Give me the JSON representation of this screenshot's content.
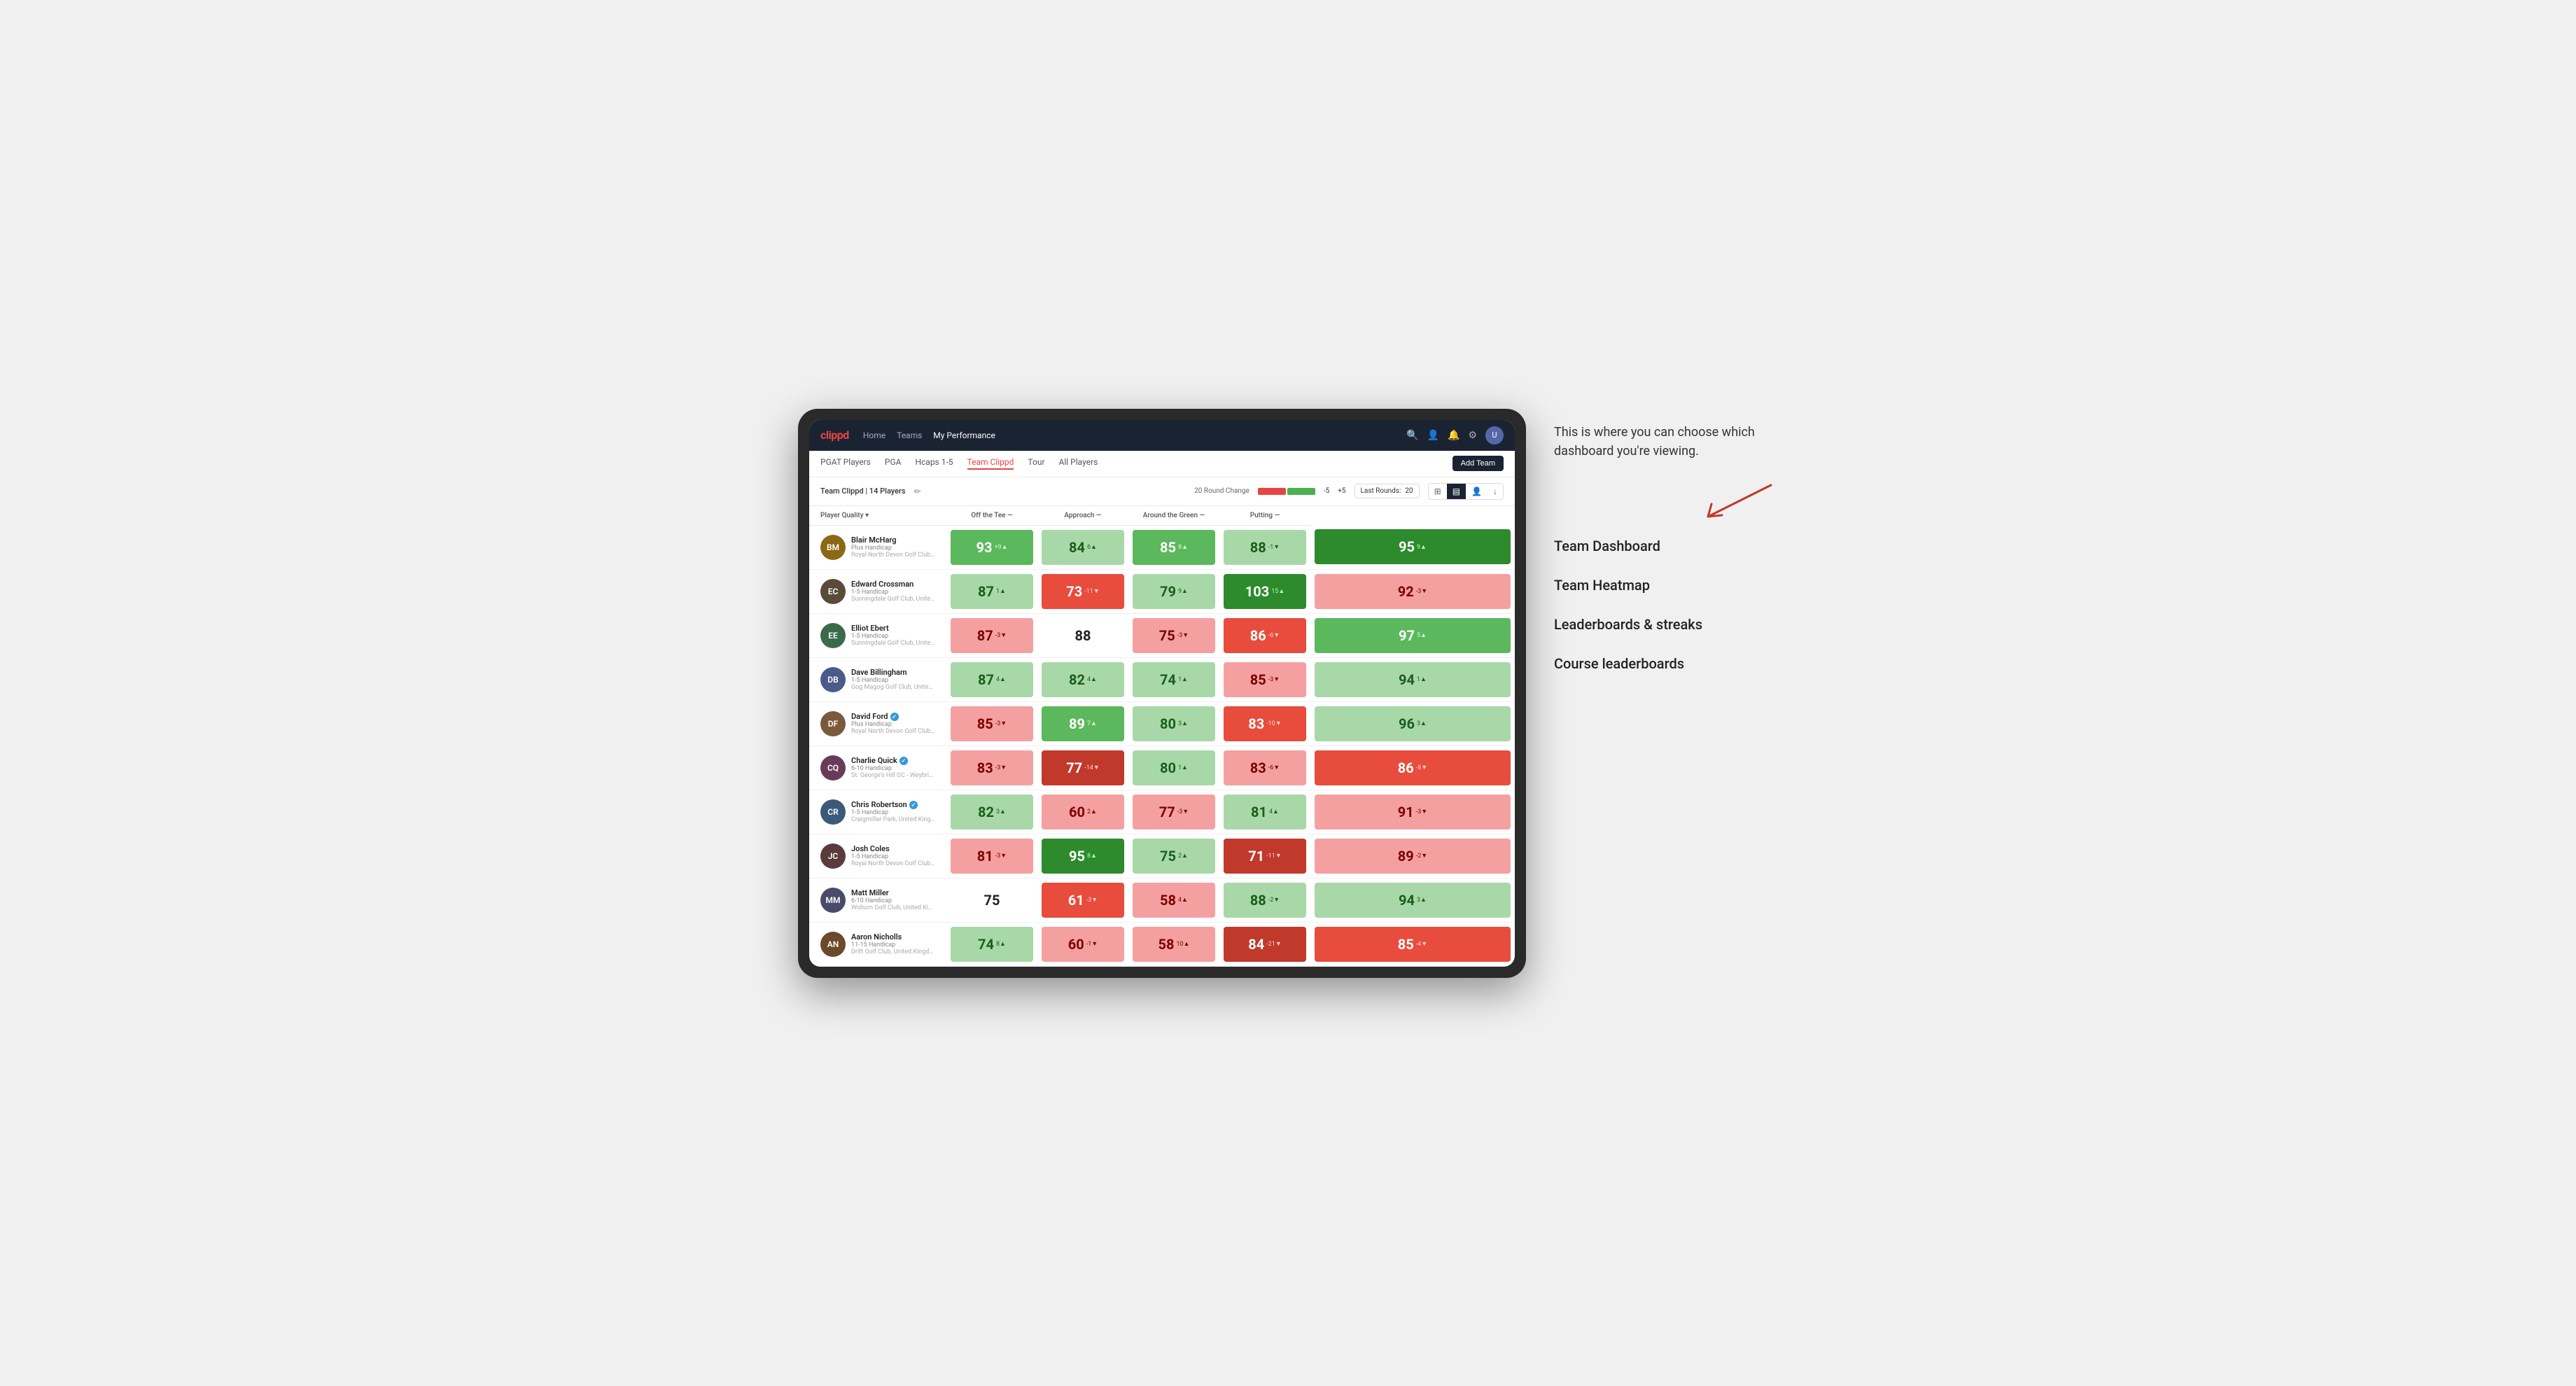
{
  "annotation": {
    "intro_text": "This is where you can choose which dashboard you're viewing.",
    "dashboard_options": [
      "Team Dashboard",
      "Team Heatmap",
      "Leaderboards & streaks",
      "Course leaderboards"
    ]
  },
  "nav": {
    "logo": "clippd",
    "links": [
      "Home",
      "Teams",
      "My Performance"
    ],
    "active_link": "My Performance"
  },
  "sub_nav": {
    "links": [
      "PGAT Players",
      "PGA",
      "Hcaps 1-5",
      "Team Clippd",
      "Tour",
      "All Players"
    ],
    "active_link": "Team Clippd",
    "add_team_label": "Add Team"
  },
  "controls": {
    "team_label": "Team Clippd",
    "player_count": "14 Players",
    "round_change_label": "20 Round Change",
    "change_minus": "-5",
    "change_plus": "+5",
    "last_rounds_label": "Last Rounds:",
    "last_rounds_value": "20"
  },
  "table": {
    "headers": {
      "player": "Player Quality ▾",
      "off_tee": "Off the Tee —",
      "approach": "Approach —",
      "around_green": "Around the Green —",
      "putting": "Putting —"
    },
    "players": [
      {
        "name": "Blair McHarg",
        "handicap": "Plus Handicap",
        "club": "Royal North Devon Golf Club, United Kingdom",
        "avatar_color": "#8B6914",
        "initials": "BM",
        "quality": {
          "value": 93,
          "change": "+9▲",
          "bg": "bg-green-mid"
        },
        "off_tee": {
          "value": 84,
          "change": "6▲",
          "bg": "bg-green-light"
        },
        "approach": {
          "value": 85,
          "change": "8▲",
          "bg": "bg-green-mid"
        },
        "around_green": {
          "value": 88,
          "change": "-1▼",
          "bg": "bg-green-light"
        },
        "putting": {
          "value": 95,
          "change": "9▲",
          "bg": "bg-green-dark"
        }
      },
      {
        "name": "Edward Crossman",
        "handicap": "1-5 Handicap",
        "club": "Sunningdale Golf Club, United Kingdom",
        "avatar_color": "#5a4a3a",
        "initials": "EC",
        "quality": {
          "value": 87,
          "change": "1▲",
          "bg": "bg-green-light"
        },
        "off_tee": {
          "value": 73,
          "change": "-11▼",
          "bg": "bg-red-mid"
        },
        "approach": {
          "value": 79,
          "change": "9▲",
          "bg": "bg-green-light"
        },
        "around_green": {
          "value": 103,
          "change": "15▲",
          "bg": "bg-green-dark"
        },
        "putting": {
          "value": 92,
          "change": "-3▼",
          "bg": "bg-red-light"
        }
      },
      {
        "name": "Elliot Ebert",
        "handicap": "1-5 Handicap",
        "club": "Sunningdale Golf Club, United Kingdom",
        "avatar_color": "#3a6a4a",
        "initials": "EE",
        "quality": {
          "value": 87,
          "change": "-3▼",
          "bg": "bg-red-light"
        },
        "off_tee": {
          "value": 88,
          "change": "",
          "bg": "bg-white"
        },
        "approach": {
          "value": 75,
          "change": "-3▼",
          "bg": "bg-red-light"
        },
        "around_green": {
          "value": 86,
          "change": "-6▼",
          "bg": "bg-red-mid"
        },
        "putting": {
          "value": 97,
          "change": "5▲",
          "bg": "bg-green-mid"
        }
      },
      {
        "name": "Dave Billingham",
        "handicap": "1-5 Handicap",
        "club": "Gog Magog Golf Club, United Kingdom",
        "avatar_color": "#4a5a8a",
        "initials": "DB",
        "quality": {
          "value": 87,
          "change": "4▲",
          "bg": "bg-green-light"
        },
        "off_tee": {
          "value": 82,
          "change": "4▲",
          "bg": "bg-green-light"
        },
        "approach": {
          "value": 74,
          "change": "1▲",
          "bg": "bg-green-light"
        },
        "around_green": {
          "value": 85,
          "change": "-3▼",
          "bg": "bg-red-light"
        },
        "putting": {
          "value": 94,
          "change": "1▲",
          "bg": "bg-green-light"
        }
      },
      {
        "name": "David Ford",
        "handicap": "Plus Handicap",
        "club": "Royal North Devon Golf Club, United Kingdom",
        "avatar_color": "#7a5a3a",
        "initials": "DF",
        "verified": true,
        "quality": {
          "value": 85,
          "change": "-3▼",
          "bg": "bg-red-light"
        },
        "off_tee": {
          "value": 89,
          "change": "7▲",
          "bg": "bg-green-mid"
        },
        "approach": {
          "value": 80,
          "change": "3▲",
          "bg": "bg-green-light"
        },
        "around_green": {
          "value": 83,
          "change": "-10▼",
          "bg": "bg-red-mid"
        },
        "putting": {
          "value": 96,
          "change": "3▲",
          "bg": "bg-green-light"
        }
      },
      {
        "name": "Charlie Quick",
        "handicap": "6-10 Handicap",
        "club": "St. George's Hill GC - Weybridge - Surrey, Uni...",
        "avatar_color": "#6a3a5a",
        "initials": "CQ",
        "verified": true,
        "quality": {
          "value": 83,
          "change": "-3▼",
          "bg": "bg-red-light"
        },
        "off_tee": {
          "value": 77,
          "change": "-14▼",
          "bg": "bg-red-dark"
        },
        "approach": {
          "value": 80,
          "change": "1▲",
          "bg": "bg-green-light"
        },
        "around_green": {
          "value": 83,
          "change": "-6▼",
          "bg": "bg-red-light"
        },
        "putting": {
          "value": 86,
          "change": "-8▼",
          "bg": "bg-red-mid"
        }
      },
      {
        "name": "Chris Robertson",
        "handicap": "1-5 Handicap",
        "club": "Craigmillar Park, United Kingdom",
        "avatar_color": "#3a5a7a",
        "initials": "CR",
        "verified": true,
        "quality": {
          "value": 82,
          "change": "3▲",
          "bg": "bg-green-light"
        },
        "off_tee": {
          "value": 60,
          "change": "2▲",
          "bg": "bg-red-light"
        },
        "approach": {
          "value": 77,
          "change": "-3▼",
          "bg": "bg-red-light"
        },
        "around_green": {
          "value": 81,
          "change": "4▲",
          "bg": "bg-green-light"
        },
        "putting": {
          "value": 91,
          "change": "-3▼",
          "bg": "bg-red-light"
        }
      },
      {
        "name": "Josh Coles",
        "handicap": "1-5 Handicap",
        "club": "Royal North Devon Golf Club, United Kingdom",
        "avatar_color": "#5a3a3a",
        "initials": "JC",
        "quality": {
          "value": 81,
          "change": "-3▼",
          "bg": "bg-red-light"
        },
        "off_tee": {
          "value": 95,
          "change": "8▲",
          "bg": "bg-green-dark"
        },
        "approach": {
          "value": 75,
          "change": "2▲",
          "bg": "bg-green-light"
        },
        "around_green": {
          "value": 71,
          "change": "-11▼",
          "bg": "bg-red-dark"
        },
        "putting": {
          "value": 89,
          "change": "-2▼",
          "bg": "bg-red-light"
        }
      },
      {
        "name": "Matt Miller",
        "handicap": "6-10 Handicap",
        "club": "Woburn Golf Club, United Kingdom",
        "avatar_color": "#4a4a6a",
        "initials": "MM",
        "quality": {
          "value": 75,
          "change": "",
          "bg": "bg-white"
        },
        "off_tee": {
          "value": 61,
          "change": "-3▼",
          "bg": "bg-red-mid"
        },
        "approach": {
          "value": 58,
          "change": "4▲",
          "bg": "bg-red-light"
        },
        "around_green": {
          "value": 88,
          "change": "-2▼",
          "bg": "bg-green-light"
        },
        "putting": {
          "value": 94,
          "change": "3▲",
          "bg": "bg-green-light"
        }
      },
      {
        "name": "Aaron Nicholls",
        "handicap": "11-15 Handicap",
        "club": "Drift Golf Club, United Kingdom",
        "avatar_color": "#6a4a2a",
        "initials": "AN",
        "quality": {
          "value": 74,
          "change": "8▲",
          "bg": "bg-green-light"
        },
        "off_tee": {
          "value": 60,
          "change": "-1▼",
          "bg": "bg-red-light"
        },
        "approach": {
          "value": 58,
          "change": "10▲",
          "bg": "bg-red-light"
        },
        "around_green": {
          "value": 84,
          "change": "-21▼",
          "bg": "bg-red-dark"
        },
        "putting": {
          "value": 85,
          "change": "-4▼",
          "bg": "bg-red-mid"
        }
      }
    ]
  }
}
